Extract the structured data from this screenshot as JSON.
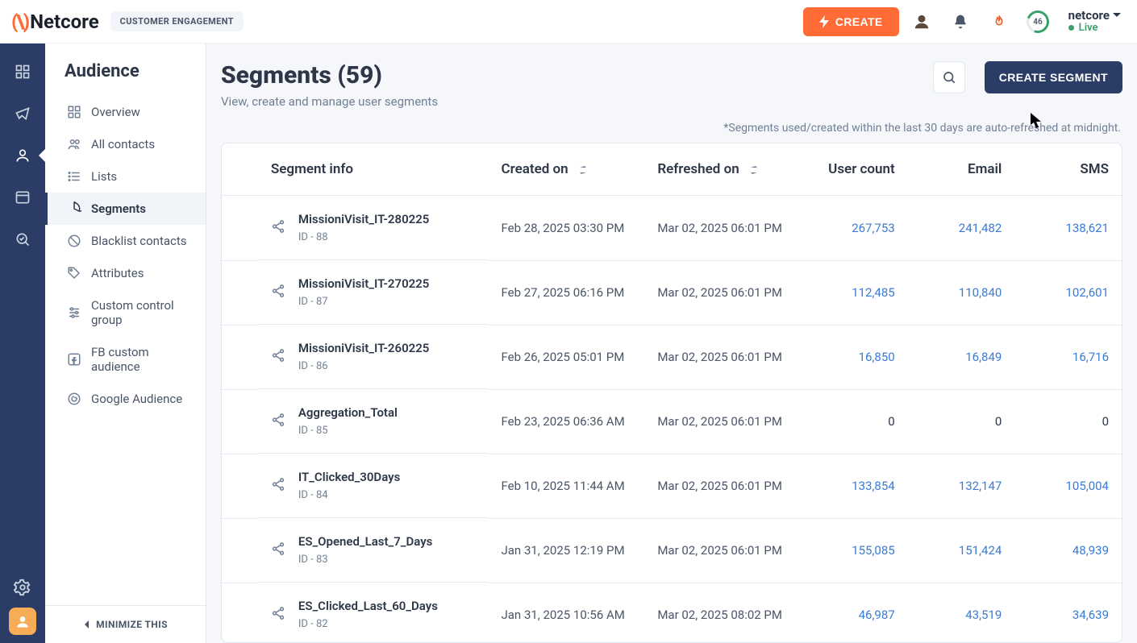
{
  "brand": {
    "name": "Netcore",
    "tag": "CUSTOMER ENGAGEMENT"
  },
  "topbar": {
    "create": "CREATE",
    "ring": "46",
    "account": {
      "name": "netcore",
      "status": "Live"
    }
  },
  "sidepanel": {
    "title": "Audience",
    "items": [
      {
        "label": "Overview"
      },
      {
        "label": "All contacts"
      },
      {
        "label": "Lists"
      },
      {
        "label": "Segments"
      },
      {
        "label": "Blacklist contacts"
      },
      {
        "label": "Attributes"
      },
      {
        "label": "Custom control group"
      },
      {
        "label": "FB custom audience"
      },
      {
        "label": "Google Audience"
      }
    ],
    "minimize": "MINIMIZE THIS"
  },
  "page": {
    "title": "Segments (59)",
    "subtitle": "View, create and manage user segments",
    "create_segment": "CREATE SEGMENT",
    "note": "*Segments used/created within the last 30 days are auto-refreshed at midnight."
  },
  "table": {
    "columns": {
      "segment": "Segment info",
      "created": "Created on",
      "refreshed": "Refreshed on",
      "user": "User count",
      "email": "Email",
      "sms": "SMS"
    },
    "id_prefix": "ID - ",
    "rows": [
      {
        "name": "MissioniVisit_IT-280225",
        "id": "88",
        "created": "Feb 28, 2025 03:30 PM",
        "refreshed": "Mar 02, 2025 06:01 PM",
        "user": "267,753",
        "email": "241,482",
        "sms": "138,621"
      },
      {
        "name": "MissioniVisit_IT-270225",
        "id": "87",
        "created": "Feb 27, 2025 06:16 PM",
        "refreshed": "Mar 02, 2025 06:01 PM",
        "user": "112,485",
        "email": "110,840",
        "sms": "102,601"
      },
      {
        "name": "MissioniVisit_IT-260225",
        "id": "86",
        "created": "Feb 26, 2025 05:01 PM",
        "refreshed": "Mar 02, 2025 06:01 PM",
        "user": "16,850",
        "email": "16,849",
        "sms": "16,716"
      },
      {
        "name": "Aggregation_Total",
        "id": "85",
        "created": "Feb 23, 2025 06:36 AM",
        "refreshed": "Mar 02, 2025 06:01 PM",
        "user": "0",
        "email": "0",
        "sms": "0"
      },
      {
        "name": "IT_Clicked_30Days",
        "id": "84",
        "created": "Feb 10, 2025 11:44 AM",
        "refreshed": "Mar 02, 2025 06:01 PM",
        "user": "133,854",
        "email": "132,147",
        "sms": "105,004"
      },
      {
        "name": "ES_Opened_Last_7_Days",
        "id": "83",
        "created": "Jan 31, 2025 12:19 PM",
        "refreshed": "Mar 02, 2025 06:01 PM",
        "user": "155,085",
        "email": "151,424",
        "sms": "48,939"
      },
      {
        "name": "ES_Clicked_Last_60_Days",
        "id": "82",
        "created": "Jan 31, 2025 10:56 AM",
        "refreshed": "Mar 02, 2025 08:02 PM",
        "user": "46,987",
        "email": "43,519",
        "sms": "34,639"
      }
    ]
  }
}
